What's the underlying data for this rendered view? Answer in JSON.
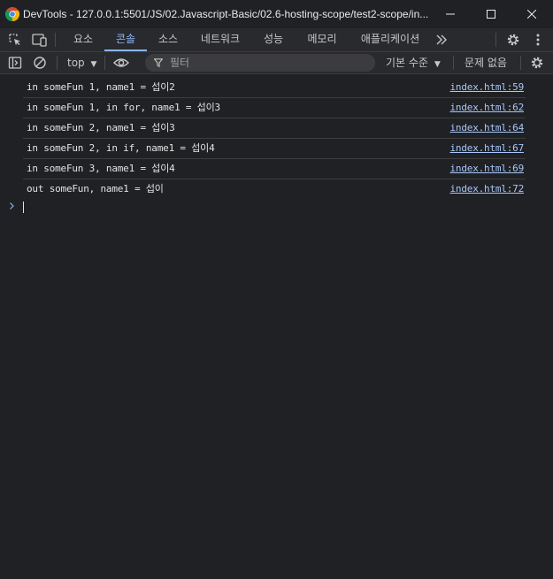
{
  "window": {
    "title": "DevTools - 127.0.0.1:5501/JS/02.Javascript-Basic/02.6-hosting-scope/test2-scope/in..."
  },
  "tabs": [
    {
      "label": "요소"
    },
    {
      "label": "콘솔"
    },
    {
      "label": "소스"
    },
    {
      "label": "네트워크"
    },
    {
      "label": "성능"
    },
    {
      "label": "메모리"
    },
    {
      "label": "애플리케이션"
    }
  ],
  "toolbar": {
    "context": "top",
    "filter_placeholder": "필터",
    "levels": "기본 수준",
    "issues": "문제 없음"
  },
  "console": {
    "messages": [
      {
        "text": "in someFun 1, name1 = 섭이2",
        "source": "index.html:59"
      },
      {
        "text": "in someFun 1, in for, name1 = 섭이3",
        "source": "index.html:62"
      },
      {
        "text": "in someFun 2, name1 = 섭이3",
        "source": "index.html:64"
      },
      {
        "text": "in someFun 2, in if, name1 = 섭이4",
        "source": "index.html:67"
      },
      {
        "text": "in someFun 3, name1 = 섭이4",
        "source": "index.html:69"
      },
      {
        "text": "out someFun, name1 = 섭이",
        "source": "index.html:72"
      }
    ]
  },
  "icons": {
    "app": "chrome-logo-icon",
    "inspect": "inspect-element-icon",
    "device": "device-toolbar-icon",
    "more_tabs": "chevron-double-right-icon",
    "settings": "gear-icon",
    "menu": "kebab-menu-icon",
    "sidebar": "sidebar-toggle-icon",
    "clear": "clear-console-icon",
    "eye": "live-expression-icon",
    "filter": "filter-icon",
    "prompt": "chevron-right-icon"
  },
  "colors": {
    "background": "#202124",
    "toolbar": "#292a2d",
    "accent": "#8ab4f8",
    "link": "#a8c7fa"
  }
}
